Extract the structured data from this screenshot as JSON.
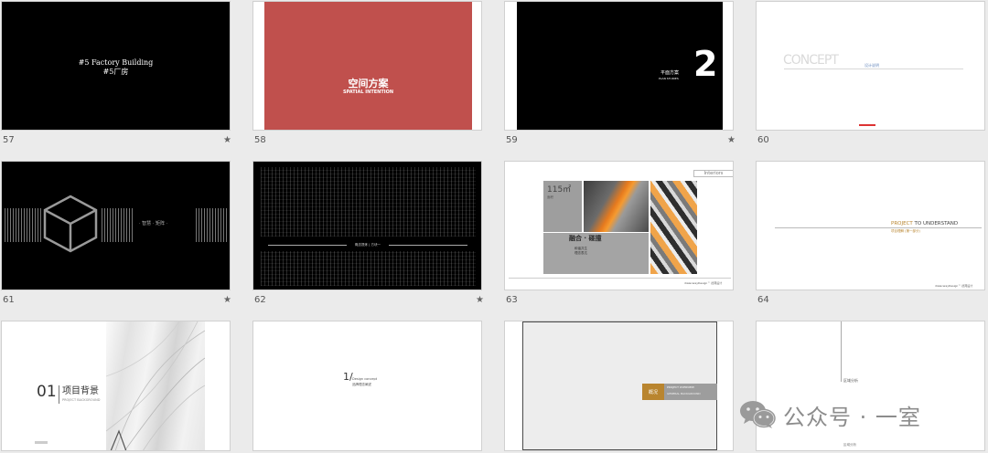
{
  "slides": {
    "s57": {
      "number": "57",
      "line1": "#5 Factory Building",
      "line2": "#5厂房"
    },
    "s58": {
      "number": "58",
      "title": "空间方案",
      "subtitle": "SPATIAL INTENTION"
    },
    "s59": {
      "number": "59",
      "big_digit": "2",
      "label1": "平面方案",
      "label2": "PLAN STUDIES"
    },
    "s60": {
      "number": "60",
      "word": "CONCEPT",
      "caption": "设计说明"
    },
    "s61": {
      "number": "61",
      "label": "· 智慧 · 矩阵 ·"
    },
    "s62": {
      "number": "62",
      "label": "概念提炼 | 方块一"
    },
    "s63": {
      "number": "63",
      "tag": "Interiors",
      "metric": "115㎡",
      "metric_sub": "面积",
      "title": "融合 · 碰撞",
      "sub1": "和谐共生",
      "sub2": "理念表达",
      "footer": "dialecwayDesign™ 德邦设计"
    },
    "s64": {
      "number": "64",
      "title_accent": "PROJECT",
      "title_rest": " TO UNDERSTAND",
      "subtitle": "项目理解 (第一部分)",
      "footer": "dialecwayDesign™ 德邦设计"
    },
    "s65": {
      "number_big": "01",
      "title": "项目背景",
      "subtitle": "PROJECT BACKGROUND"
    },
    "s66": {
      "slash_num": "1/",
      "en": "Design concept",
      "cn": "品牌理念阐述"
    },
    "s67": {
      "label": "概况",
      "en": "PROJECT OVERVIEW",
      "en2": "GENERAL BACKGROUND"
    },
    "s68": {
      "label": "区域分析",
      "bottom": "区域分析"
    }
  },
  "starred": [
    "57",
    "59",
    "61",
    "62"
  ],
  "star_glyph": "★",
  "watermark": {
    "text": "公众号 · 一室",
    "icon": "wechat-icon"
  },
  "colors": {
    "background": "#ebebeb",
    "red": "#c0504d",
    "gold": "#b9852f"
  }
}
